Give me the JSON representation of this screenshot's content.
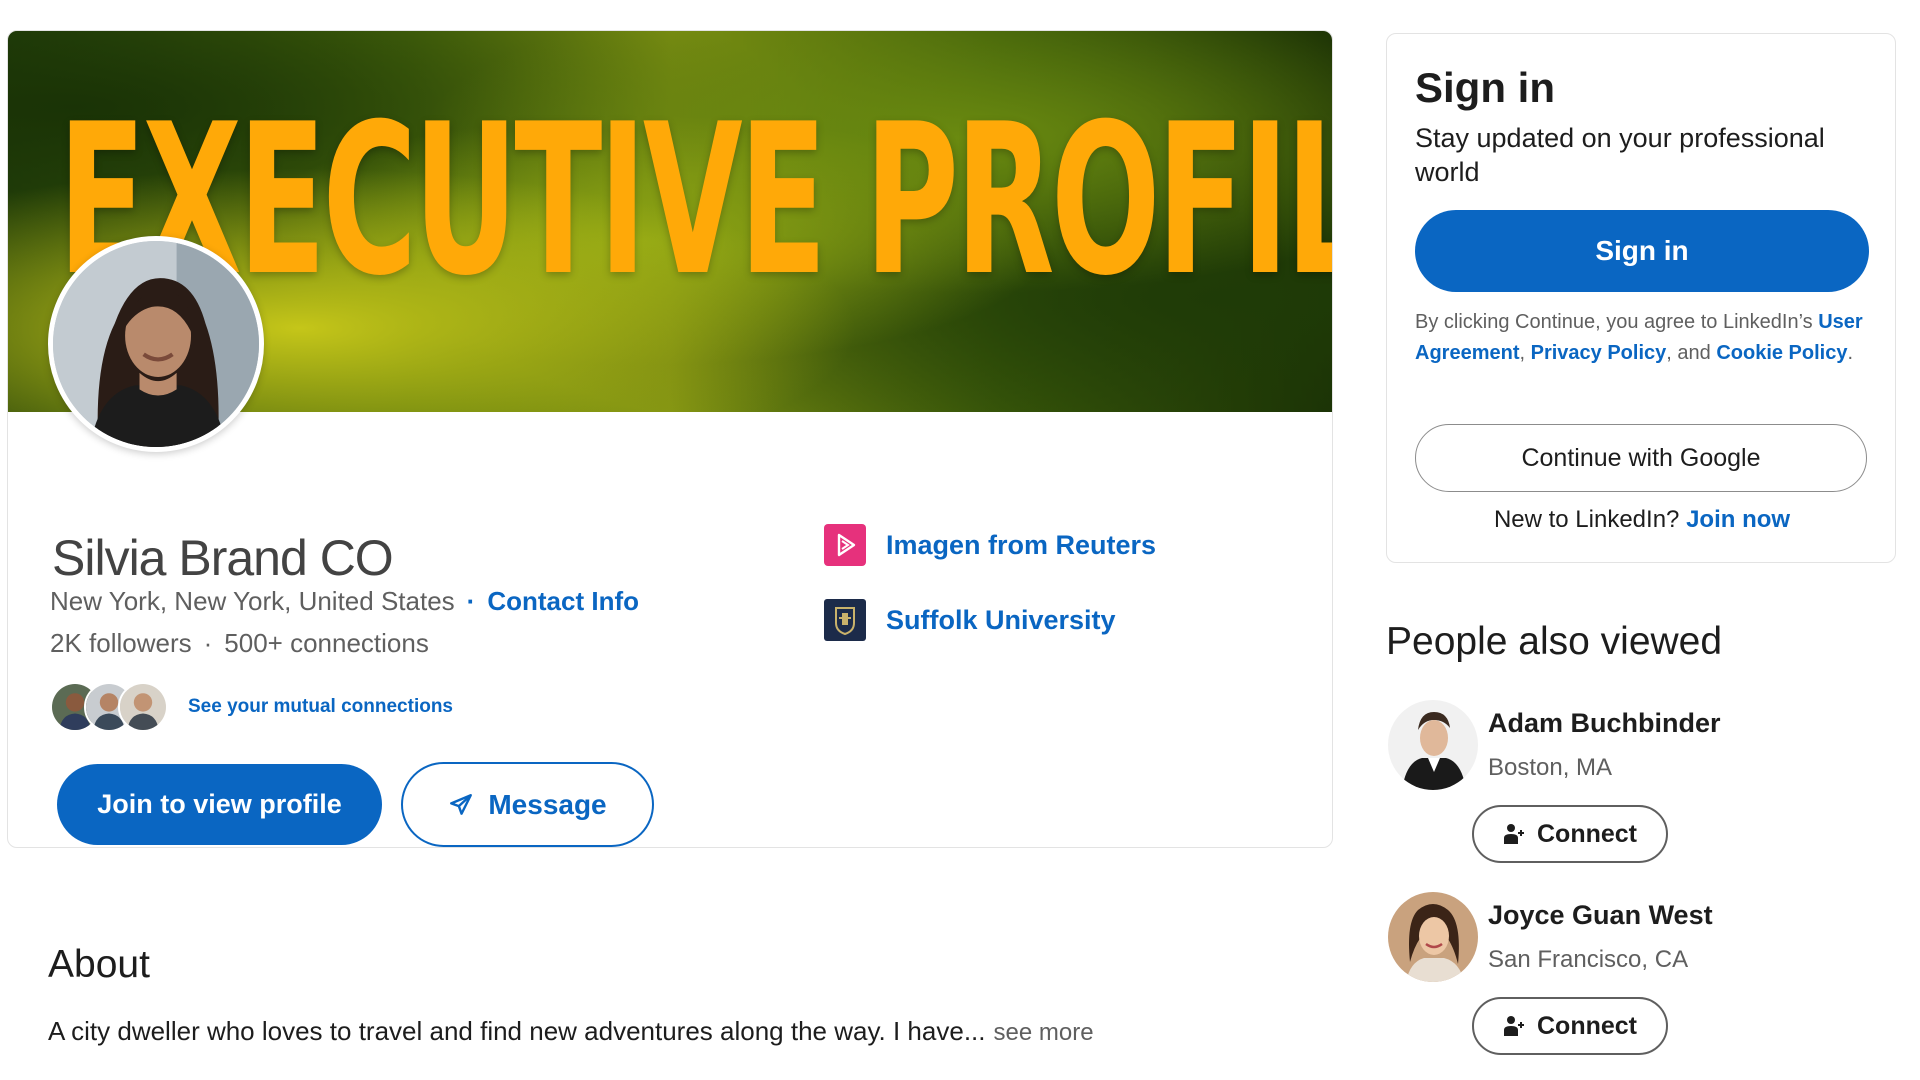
{
  "profile": {
    "cover_text": "EXECUTIVE PROFILE",
    "name": "Silvia Brand CO",
    "location": "New York, New York, United States",
    "contact_label": "Contact Info",
    "followers": "2K followers",
    "connections": "500+ connections",
    "mutual_label": "See your mutual connections",
    "join_label": "Join to view profile",
    "message_label": "Message",
    "affiliations": [
      {
        "label": "Imagen from Reuters",
        "icon": "reuters-logo-icon",
        "color": "#e6317c"
      },
      {
        "label": "Suffolk University",
        "icon": "suffolk-crest-icon",
        "color": "#1c2b4a"
      }
    ]
  },
  "about": {
    "title": "About",
    "text": "A city dweller who loves to travel and find new adventures along the way. I have...",
    "see_more": "see more"
  },
  "signin": {
    "title": "Sign in",
    "subtitle": "Stay updated on your professional world",
    "button": "Sign in",
    "legal_prefix": "By clicking Continue, you agree to LinkedIn’s",
    "user_agreement": "User Agreement",
    "comma": ",",
    "privacy_policy": "Privacy Policy",
    "and": ", and",
    "cookie_policy": "Cookie Policy",
    "period": ".",
    "google_button": "Continue with Google",
    "new_to": "New to LinkedIn?",
    "join_now": "Join now"
  },
  "people_also_viewed": {
    "title": "People also viewed",
    "connect_label": "Connect",
    "people": [
      {
        "name": "Adam Buchbinder",
        "location": "Boston, MA"
      },
      {
        "name": "Joyce Guan West",
        "location": "San Francisco, CA"
      }
    ]
  },
  "colors": {
    "accent": "#0a66c2",
    "cover_text": "#ffa908"
  }
}
